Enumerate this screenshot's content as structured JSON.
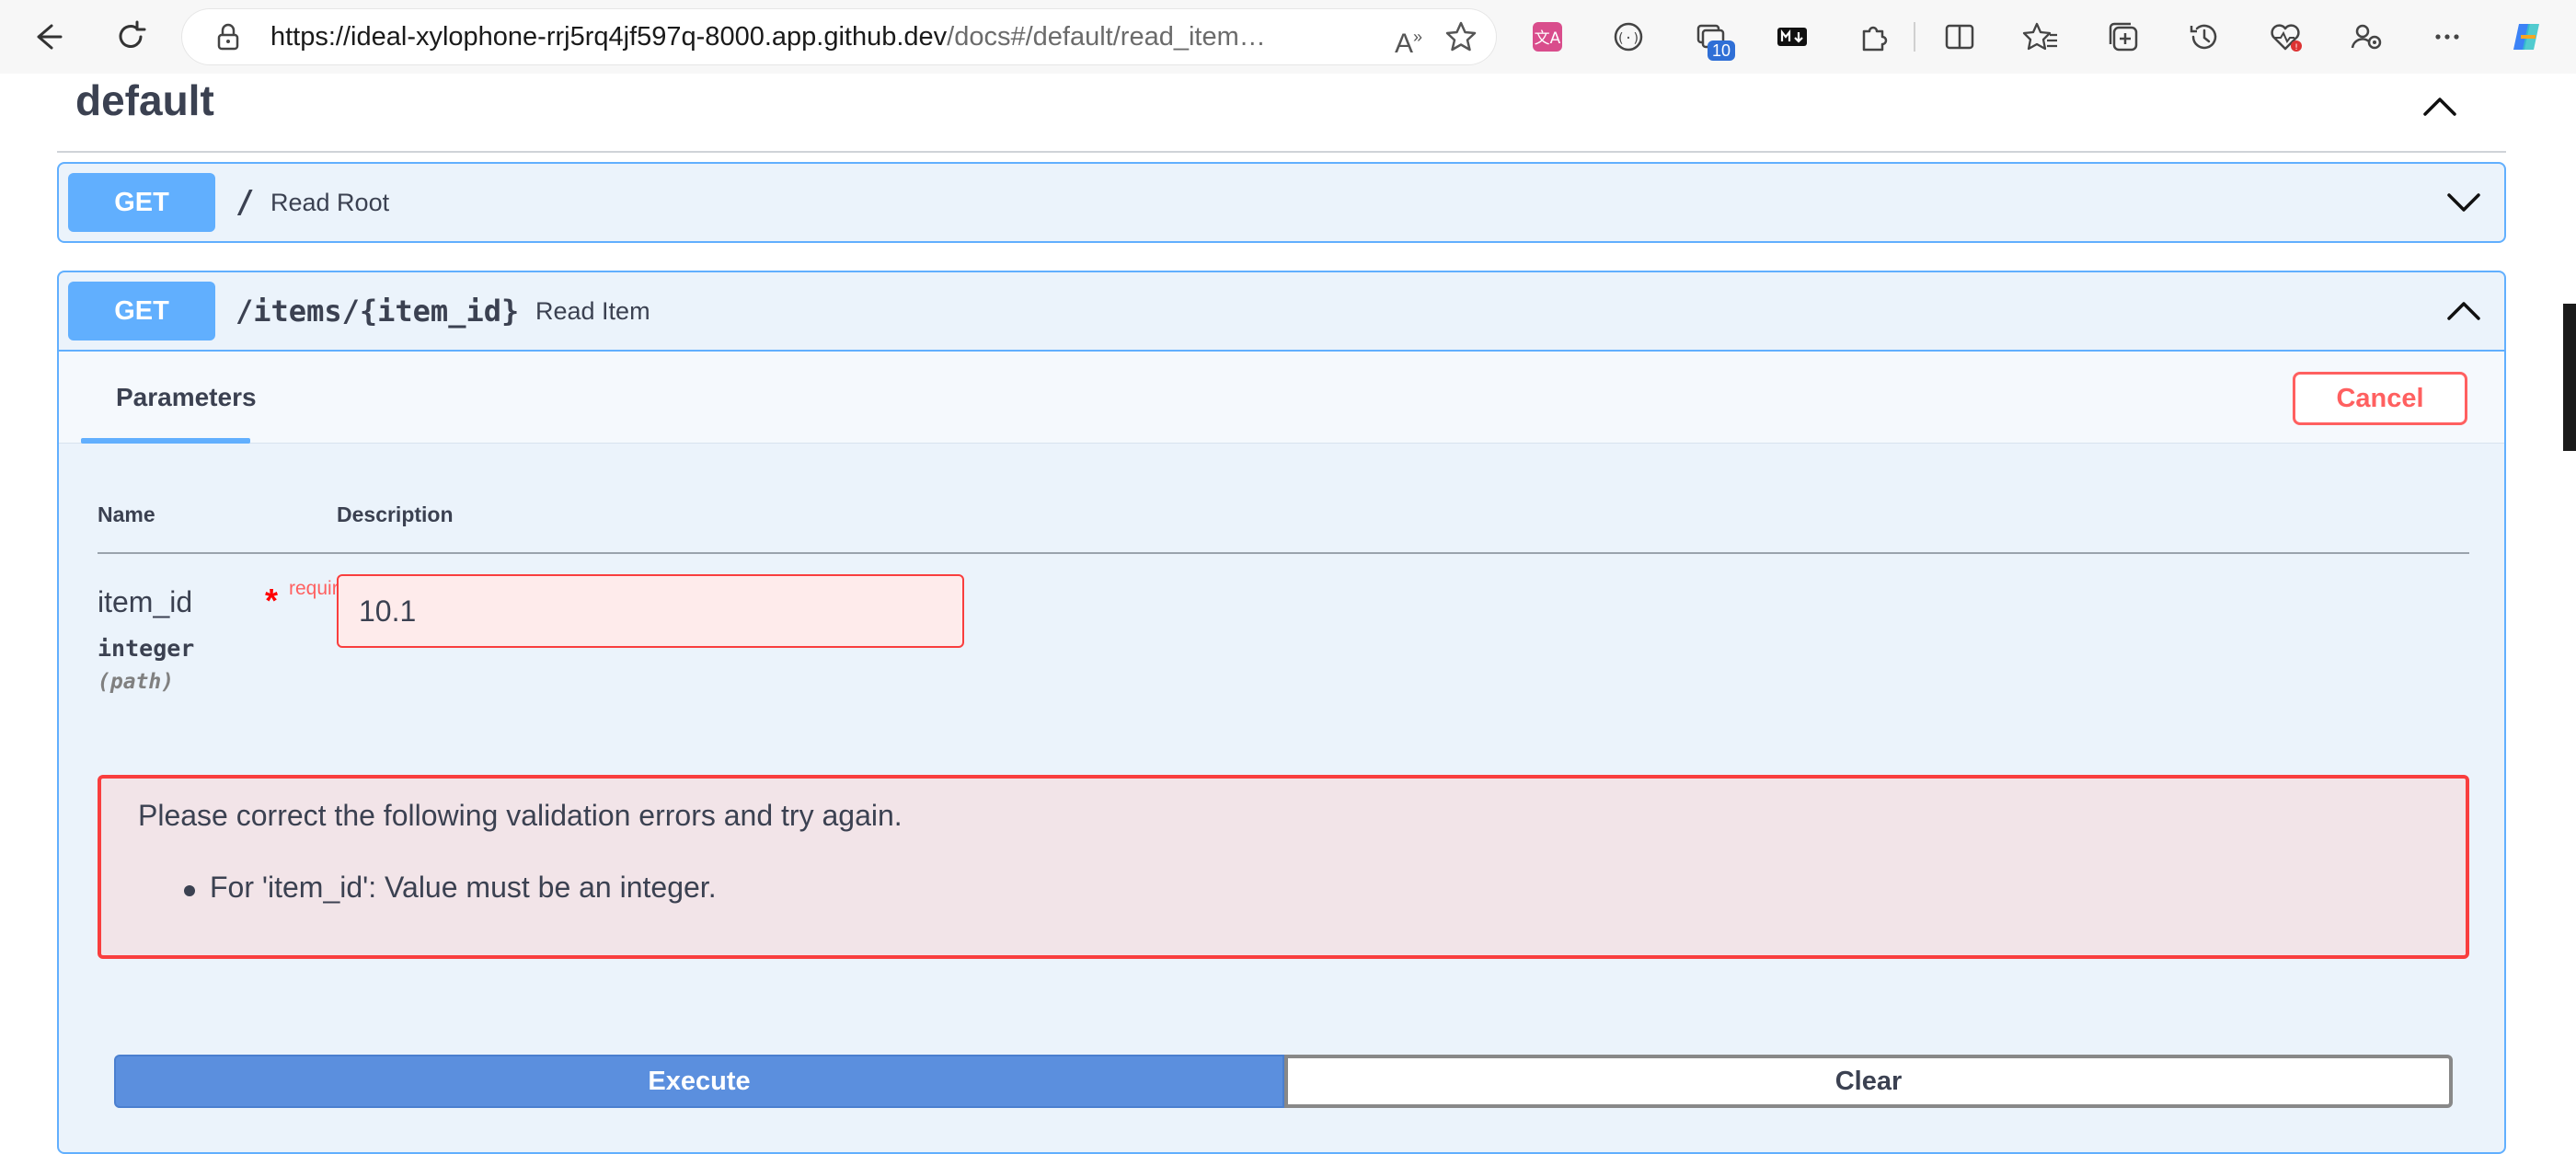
{
  "browser": {
    "url_host": "https://ideal-xylophone-rrj5rq4jf597q-8000.app.github.dev",
    "url_rest": "/docs#/default/read_item…",
    "tab_count_badge": "10",
    "read_aloud_glyph": "A",
    "read_aloud_superscript": "»",
    "icons": {
      "back": "back-arrow-icon",
      "refresh": "refresh-icon",
      "lock": "lock-icon",
      "read_aloud": "read-aloud-icon",
      "favorite": "star-icon",
      "translate": "translate-icon",
      "dev_tools": "dev-tools-icon",
      "tabs": "tab-actions-icon",
      "markdown": "markdown-icon",
      "extensions": "extensions-icon",
      "split_screen": "split-screen-icon",
      "favorites": "favorites-icon",
      "collections": "collections-icon",
      "history": "history-icon",
      "health": "browser-essentials-icon",
      "profile": "profile-icon",
      "more": "more-icon",
      "copilot": "copilot-icon"
    }
  },
  "section": {
    "title": "default"
  },
  "operations": [
    {
      "method": "GET",
      "path": "/",
      "summary": "Read Root",
      "expanded": false
    },
    {
      "method": "GET",
      "path": "/items/{item_id}",
      "summary": "Read Item",
      "expanded": true
    }
  ],
  "op_body": {
    "tab_label": "Parameters",
    "cancel_label": "Cancel",
    "col_name": "Name",
    "col_description": "Description",
    "param": {
      "name": "item_id",
      "required_star": "*",
      "required_label": "required",
      "type": "integer",
      "location": "(path)",
      "value": "10.1"
    },
    "errors": {
      "title": "Please correct the following validation errors and try again.",
      "items": [
        "For 'item_id': Value must be an integer."
      ]
    },
    "execute_label": "Execute",
    "clear_label": "Clear"
  },
  "colors": {
    "get_accent": "#61affe",
    "error_red": "#f93e3e",
    "execute_blue": "#5b8fde"
  }
}
